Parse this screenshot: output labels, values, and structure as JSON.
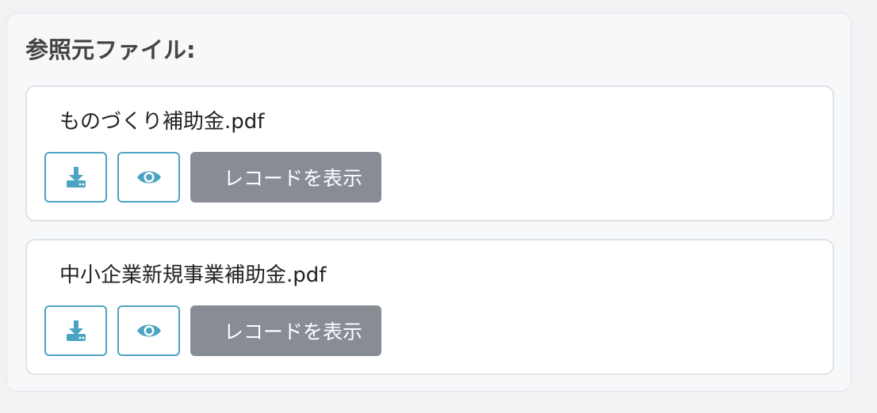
{
  "panel": {
    "title": "参照元ファイル:"
  },
  "files": [
    {
      "name": "ものづくり補助金.pdf",
      "download_icon": "download-icon",
      "view_icon": "eye-icon",
      "record_label": "レコードを表示"
    },
    {
      "name": "中小企業新規事業補助金.pdf",
      "download_icon": "download-icon",
      "view_icon": "eye-icon",
      "record_label": "レコードを表示"
    }
  ],
  "colors": {
    "accent": "#4ca4c3",
    "record_button": "#878c95"
  }
}
